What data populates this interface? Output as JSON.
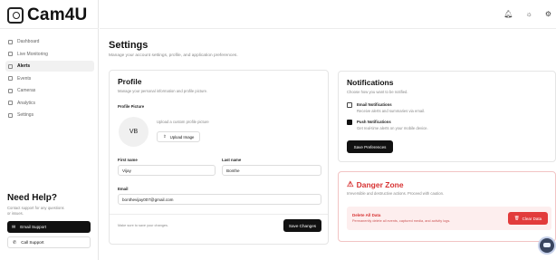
{
  "app": {
    "name": "Cam4U"
  },
  "sidebar": {
    "items": [
      {
        "label": "Dashboard",
        "icon": "grid-icon"
      },
      {
        "label": "Live Monitoring",
        "icon": "video-icon"
      },
      {
        "label": "Alerts",
        "icon": "bell-icon",
        "active": true
      },
      {
        "label": "Events",
        "icon": "list-icon"
      },
      {
        "label": "Cameras",
        "icon": "camera-icon"
      },
      {
        "label": "Analytics",
        "icon": "bar-chart-icon"
      },
      {
        "label": "Settings",
        "icon": "gear-icon"
      }
    ],
    "help": {
      "title": "Need Help?",
      "description": "Contact support for any questions or issues.",
      "email_label": "Email Support",
      "call_label": "Call Support"
    }
  },
  "topbar": {
    "icons": [
      "bell-icon",
      "sun-icon",
      "gear-icon"
    ]
  },
  "page": {
    "title": "Settings",
    "subtitle": "Manage your account settings, profile, and application preferences."
  },
  "profile": {
    "title": "Profile",
    "subtitle": "Manage your personal information and profile picture.",
    "picture_label": "Profile Picture",
    "avatar_initials": "VB",
    "upload_hint": "Upload a custom profile picture",
    "upload_label": "Upload Image",
    "first_name_label": "First name",
    "first_name_value": "Vijay",
    "last_name_label": "Last name",
    "last_name_value": "Bonthe",
    "email_label": "Email",
    "email_value": "bonthevijay007@gmail.com",
    "footer_hint": "Make sure to save your changes.",
    "save_label": "Save Changes"
  },
  "notifications": {
    "title": "Notifications",
    "subtitle": "Choose how you want to be notified.",
    "options": [
      {
        "label": "Email Notifications",
        "desc": "Receive alerts and summaries via email.",
        "checked": false
      },
      {
        "label": "Push Notifications",
        "desc": "Get real-time alerts on your mobile device.",
        "checked": true
      }
    ],
    "save_label": "Save Preferences"
  },
  "danger": {
    "title": "Danger Zone",
    "subtitle": "Irreversible and destructive actions. Proceed with caution.",
    "item_title": "Delete All Data",
    "item_desc": "Permanently delete all events, captured media, and activity logs.",
    "clear_label": "Clear Data"
  },
  "colors": {
    "danger": "#e23b3b",
    "primary": "#111111"
  }
}
